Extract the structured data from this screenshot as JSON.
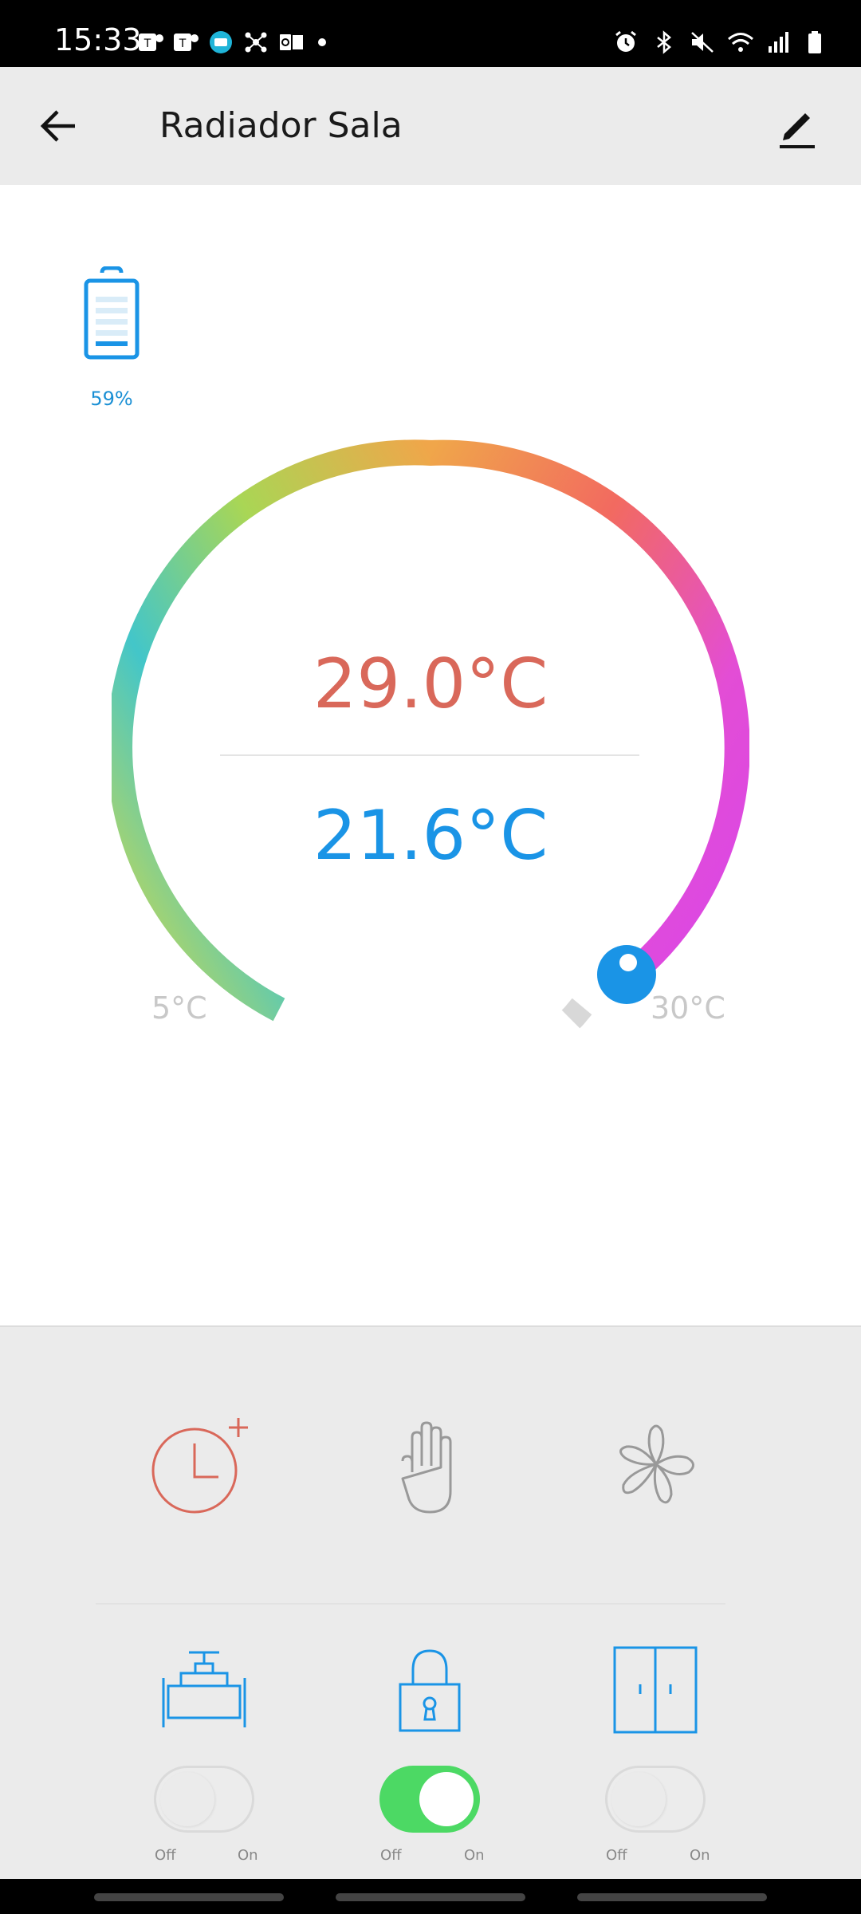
{
  "status_bar": {
    "time": "15:33",
    "left_icons": [
      "teams-icon",
      "teams-icon",
      "vpn-badge-icon",
      "network-icon",
      "outlook-icon",
      "dot-icon"
    ],
    "right_icons": [
      "alarm-icon",
      "bluetooth-icon",
      "mute-icon",
      "wifi-icon",
      "signal-icon",
      "battery-icon"
    ]
  },
  "header": {
    "title": "Radiador Sala",
    "back_icon": "arrow-back-icon",
    "edit_icon": "edit-pencil-icon"
  },
  "device": {
    "battery_percent": "59%",
    "battery_level": 0.59
  },
  "thermostat": {
    "setpoint": "29.0°C",
    "current": "21.6°C",
    "min_label": "5°C",
    "max_label": "30°C",
    "min_value": 5,
    "max_value": 30,
    "setpoint_value": 29.0,
    "colors": {
      "setpoint": "#d9685a",
      "current": "#1a94e6",
      "knob": "#1a94e6"
    }
  },
  "modes": [
    {
      "name": "schedule",
      "icon": "clock-plus-icon",
      "color": "#d9685a"
    },
    {
      "name": "manual",
      "icon": "hand-icon",
      "color": "#999999"
    },
    {
      "name": "eco",
      "icon": "flower-icon",
      "color": "#999999"
    }
  ],
  "features": [
    {
      "name": "valve",
      "icon": "valve-icon",
      "off_label": "Off",
      "on_label": "On",
      "on": false
    },
    {
      "name": "child-lock",
      "icon": "lock-icon",
      "off_label": "Off",
      "on_label": "On",
      "on": true
    },
    {
      "name": "window",
      "icon": "window-icon",
      "off_label": "Off",
      "on_label": "On",
      "on": false
    }
  ],
  "colors": {
    "accent": "#1a94e6",
    "toggle_on": "#4cd964"
  }
}
